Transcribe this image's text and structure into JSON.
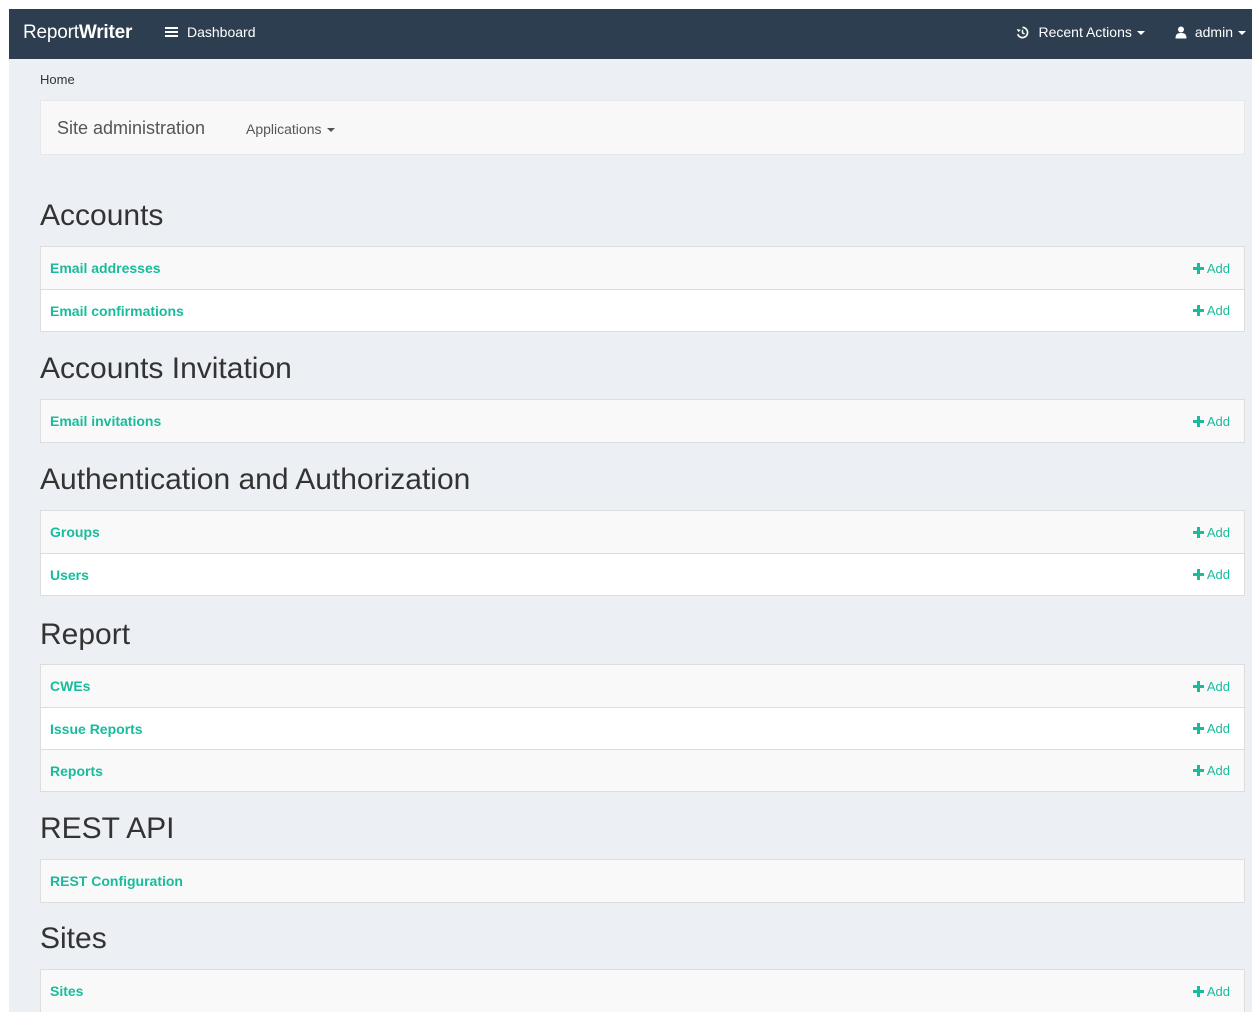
{
  "header": {
    "brand_prefix": "Report",
    "brand_bold": "Writer",
    "dashboard_label": "Dashboard",
    "recent_actions_label": "Recent Actions",
    "user_label": "admin"
  },
  "breadcrumb": "Home",
  "subnav": {
    "title": "Site administration",
    "applications_label": "Applications"
  },
  "add_label": "Add",
  "sections": [
    {
      "title": "Accounts",
      "rows": [
        {
          "label": "Email addresses",
          "add": true
        },
        {
          "label": "Email confirmations",
          "add": true
        }
      ]
    },
    {
      "title": "Accounts Invitation",
      "rows": [
        {
          "label": "Email invitations",
          "add": true
        }
      ]
    },
    {
      "title": "Authentication and Authorization",
      "rows": [
        {
          "label": "Groups",
          "add": true
        },
        {
          "label": "Users",
          "add": true
        }
      ]
    },
    {
      "title": "Report",
      "rows": [
        {
          "label": "CWEs",
          "add": true
        },
        {
          "label": "Issue Reports",
          "add": true
        },
        {
          "label": "Reports",
          "add": true
        }
      ]
    },
    {
      "title": "REST API",
      "rows": [
        {
          "label": "REST Configuration",
          "add": false
        }
      ]
    },
    {
      "title": "Sites",
      "rows": [
        {
          "label": "Sites",
          "add": true
        }
      ]
    }
  ],
  "colors": {
    "navbar": "#2c3e50",
    "link": "#18bc9c",
    "background": "#ecf0f5"
  }
}
